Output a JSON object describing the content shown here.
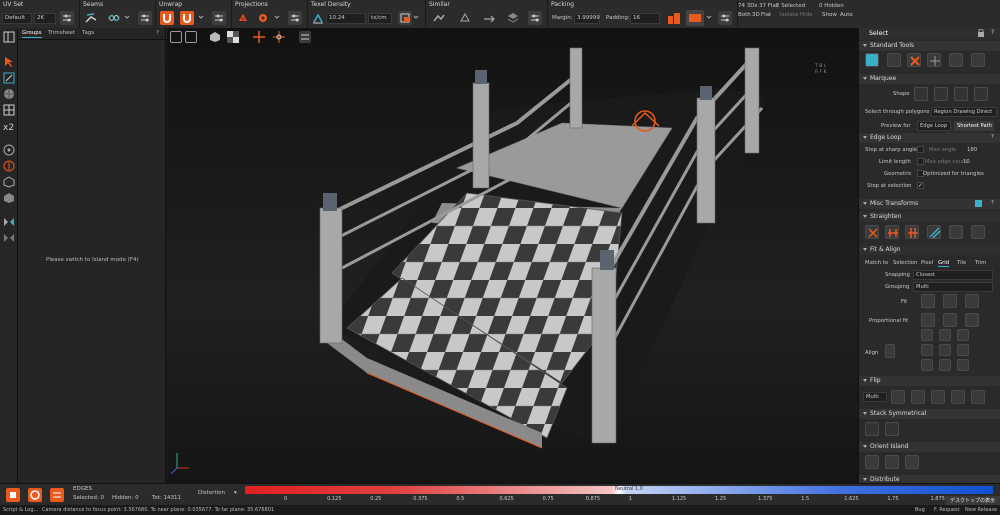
{
  "toolbar": {
    "groups": [
      {
        "id": "uvset",
        "title": "UV Set"
      },
      {
        "id": "seams",
        "title": "Seams"
      },
      {
        "id": "unwrap",
        "title": "Unwrap"
      },
      {
        "id": "projections",
        "title": "Projections"
      },
      {
        "id": "texel",
        "title": "Texel Density"
      },
      {
        "id": "similar",
        "title": "Similar"
      },
      {
        "id": "packing",
        "title": "Packing"
      }
    ],
    "uvset_value": "Default",
    "uvset_size": "2K",
    "texel_value": "10.24",
    "texel_unit": "tx/cm",
    "margin_label": "Margin:",
    "margin_value": "3.99999",
    "padding_label": "Padding:",
    "padding_value": "16",
    "stats": {
      "counts": "74 3Ds 37 Flat",
      "selected": "2 Selected",
      "hidden": "0 Hidden",
      "both": "Both",
      "three_d": "3D",
      "flat": "Flat",
      "isolate": "Isolate",
      "hide": "Hide",
      "show": "Show",
      "auto": "Auto"
    }
  },
  "groups_panel": {
    "tabs": [
      "Groups",
      "Trimsheet",
      "Tags"
    ],
    "help": "?",
    "message": "Please switch to Island mode (F4)"
  },
  "viewport": {
    "tile_letters": [
      "T",
      "B",
      "L",
      "R",
      "F",
      "K"
    ]
  },
  "right_panel": {
    "title": "Select",
    "sections": {
      "standard_tools": "Standard Tools",
      "marquee": "Marquee",
      "edge_loop": "Edge Loop",
      "misc_transforms": "Misc Transforms",
      "straighten": "Straighten",
      "fit_align": "Fit & Align",
      "flip": "Flip",
      "stack_symmetrical": "Stack Symmetrical",
      "orient_island": "Orient Island",
      "distribute": "Distribute"
    },
    "shape_label": "Shape",
    "select_through": "Select through polygons",
    "region_drawing": "Region Drawing Direct",
    "preview_for": "Preview for",
    "edge_loop_btn": "Edge Loop",
    "shortest_path_btn": "Shortest Path",
    "stop_sharp": "Stop at sharp angle",
    "max_angle_label": "Max angle",
    "max_angle_value": "180",
    "limit_length": "Limit length",
    "max_edge_label": "Max edge count",
    "max_edge_value": "10",
    "geometric": "Geometric",
    "optimized": "Optimized for triangles",
    "stop_selection": "Stop at selection",
    "help": "?",
    "match_to": "Match to",
    "match_options": [
      "Selection",
      "Pixel",
      "Grid",
      "Tile",
      "Trim"
    ],
    "snapping_label": "Snapping",
    "snapping_value": "Closest",
    "grouping_label": "Grouping",
    "grouping_value": "Multi",
    "fit_label": "Fit",
    "prop_fit_label": "Proportional fit",
    "align_label": "Align",
    "flip_value": "Multi"
  },
  "bottom": {
    "mode": "EDGES",
    "selected": "Selected: 0",
    "hidden": "Hidden: 0",
    "total": "Tot: 14311",
    "display": "Distortion",
    "neutral": "Neutral 1.0",
    "ticks": [
      "0",
      "0.125",
      "0.25",
      "0.375",
      "0.5",
      "0.625",
      "0.75",
      "0.875",
      "1",
      "1.125",
      "1.25",
      "1.375",
      "1.5",
      "1.625",
      "1.75",
      "1.875"
    ],
    "desktop_popup": "デスクトップの表示"
  },
  "status": {
    "script": "Script & Log...",
    "camera": "Camera distance to focus point: 3.567680. To near plane: 0.035677. To far plane: 35.676801",
    "bug": "Bug",
    "feature": "F. Request",
    "release": "New Release"
  },
  "colors": {
    "accent": "#e85a1e",
    "cyan": "#3ab0c8",
    "panel": "#2a2a2a"
  }
}
